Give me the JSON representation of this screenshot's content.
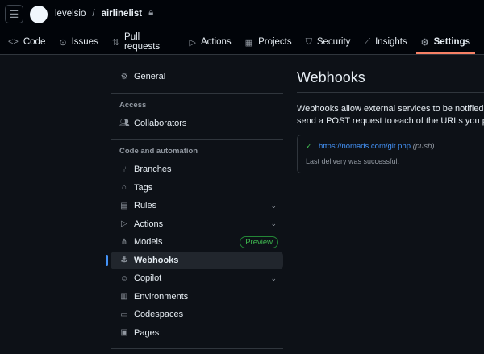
{
  "header": {
    "owner": "levelsio",
    "separator": "/",
    "repo": "airlinelist"
  },
  "tabs": [
    {
      "label": "Code",
      "icon": "<>"
    },
    {
      "label": "Issues",
      "icon": "⊙"
    },
    {
      "label": "Pull requests",
      "icon": "⇅"
    },
    {
      "label": "Actions",
      "icon": "▷"
    },
    {
      "label": "Projects",
      "icon": "▦"
    },
    {
      "label": "Security",
      "icon": "⛉"
    },
    {
      "label": "Insights",
      "icon": "⟋"
    },
    {
      "label": "Settings",
      "icon": "⚙"
    }
  ],
  "sidebar": {
    "general": "General",
    "access_heading": "Access",
    "collaborators": "Collaborators",
    "code_heading": "Code and automation",
    "items": [
      {
        "label": "Branches"
      },
      {
        "label": "Tags"
      },
      {
        "label": "Rules"
      },
      {
        "label": "Actions"
      },
      {
        "label": "Models",
        "badge": "Preview"
      },
      {
        "label": "Webhooks"
      },
      {
        "label": "Copilot"
      },
      {
        "label": "Environments"
      },
      {
        "label": "Codespaces"
      },
      {
        "label": "Pages"
      }
    ]
  },
  "main": {
    "title": "Webhooks",
    "desc_line1": "Webhooks allow external services to be notified whe",
    "desc_line2": "send a POST request to each of the URLs you provi",
    "webhook": {
      "url": "https://nomads.com/git.php",
      "event": "(push)",
      "status": "Last delivery was successful."
    }
  }
}
